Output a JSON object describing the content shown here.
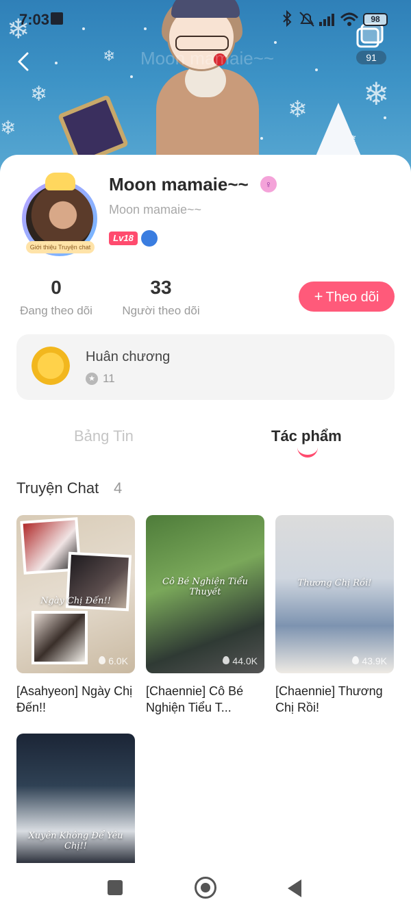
{
  "status_bar": {
    "time": "7:03",
    "battery": "98"
  },
  "banner": {
    "ghost_title": "Moon mamaie~~",
    "notification_count": "91"
  },
  "profile": {
    "name": "Moon mamaie~~",
    "subtitle": "Moon mamaie~~",
    "level": "Lv18",
    "avatar_caption": "Giới thiệu Truyện chat",
    "gender_symbol": "♀"
  },
  "stats": {
    "following": {
      "value": "0",
      "label": "Đang theo dõi"
    },
    "followers": {
      "value": "33",
      "label": "Người theo dõi"
    }
  },
  "follow_button": {
    "plus": "+",
    "label": "Theo dõi"
  },
  "medal": {
    "title": "Huân chương",
    "star": "★",
    "count": "11"
  },
  "tabs": [
    {
      "label": "Bảng Tin",
      "active": false
    },
    {
      "label": "Tác phẩm",
      "active": true
    }
  ],
  "section": {
    "title": "Truyện Chat",
    "count": "4"
  },
  "stories": [
    {
      "thumb_text": "Ngày Chị Đến!!",
      "views": "6.0K",
      "title": "[Asahyeon] Ngày Chị Đến!!"
    },
    {
      "thumb_text": "Cô Bé Nghiện Tiểu Thuyết",
      "views": "44.0K",
      "title": "[Chaennie] Cô Bé Nghiện Tiểu T..."
    },
    {
      "thumb_text": "Thương Chị Rồi!",
      "views": "43.9K",
      "title": "[Chaennie] Thương Chị Rồi!"
    },
    {
      "thumb_text": "Xuyên Không Để Yêu Chị!!",
      "views": "",
      "title": ""
    }
  ],
  "colors": {
    "accent": "#ff5a7a",
    "banner": "#3d93c6"
  }
}
